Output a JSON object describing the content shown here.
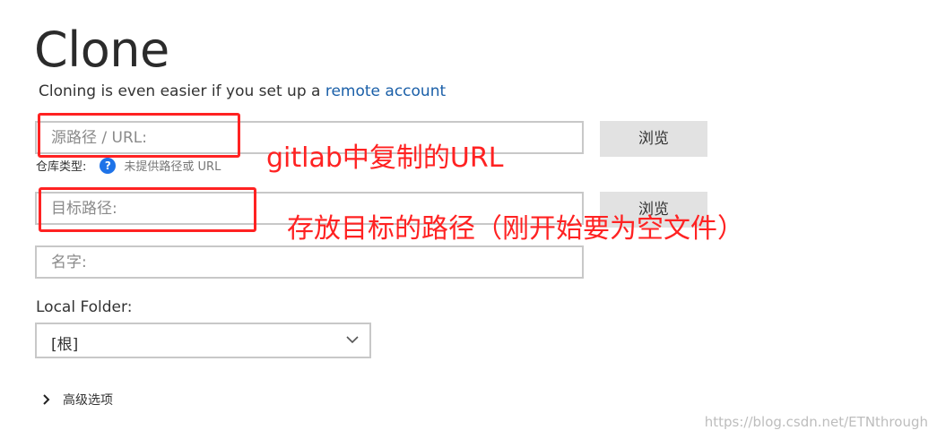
{
  "header": {
    "title": "Clone",
    "subtitle_prefix": "Cloning is even easier if you set up a ",
    "subtitle_link": "remote account"
  },
  "form": {
    "source_placeholder": "源路径 / URL:",
    "browse_label": "浏览",
    "repo_type_label": "仓库类型:",
    "repo_type_hint": "未提供路径或 URL",
    "help_glyph": "?",
    "dest_placeholder": "目标路径:",
    "name_placeholder": "名字:",
    "local_folder_label": "Local Folder:",
    "local_folder_value": "[根]",
    "advanced_label": "高级选项"
  },
  "annotations": {
    "source_note": "gitlab中复制的URL",
    "dest_note": "存放目标的路径（刚开始要为空文件）",
    "color": "#ff2222"
  },
  "watermark": "https://blog.csdn.net/ETNthrough",
  "colors": {
    "link": "#1a5fa8",
    "help_icon": "#1e73e8",
    "button_bg": "#e2e2e2"
  }
}
